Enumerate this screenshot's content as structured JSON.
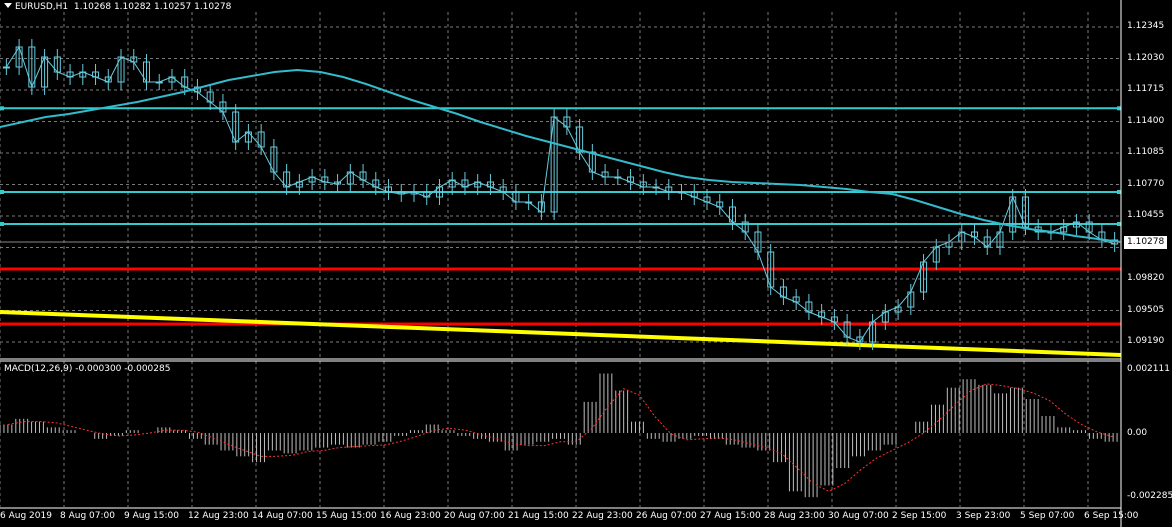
{
  "header": {
    "symbol": "EURUSD,H1",
    "ohlc": "1.10268 1.10282 1.10257 1.10278"
  },
  "macd": {
    "label": "MACD(12,26,9) -0.000300 -0.000285",
    "axis": [
      "0.002111",
      "0.00",
      "-0.002285"
    ]
  },
  "price_axis": [
    "1.12345",
    "1.12030",
    "1.11715",
    "1.11400",
    "1.11085",
    "1.10770",
    "1.10455",
    "1.10135",
    "1.09820",
    "1.09505",
    "1.09190"
  ],
  "current_price": "1.10278",
  "time_axis": [
    "6 Aug 2019",
    "8 Aug 07:00",
    "9 Aug 15:00",
    "12 Aug 23:00",
    "14 Aug 07:00",
    "15 Aug 15:00",
    "16 Aug 23:00",
    "20 Aug 07:00",
    "21 Aug 15:00",
    "22 Aug 23:00",
    "26 Aug 07:00",
    "27 Aug 15:00",
    "28 Aug 23:00",
    "30 Aug 07:00",
    "2 Sep 15:00",
    "3 Sep 23:00",
    "5 Sep 07:00",
    "6 Sep 15:00"
  ],
  "colors": {
    "background": "#000000",
    "grid": "#7a7a7a",
    "candles": "#66ccdd",
    "moving_average": "#33bbcc",
    "level_cyan": "#33cccc",
    "level_red": "#ff0000",
    "trend_yellow": "#ffff00",
    "macd_hist": "#bfbfbf",
    "macd_signal": "#ff3333"
  },
  "chart_data": {
    "type": "line",
    "instrument": "EURUSD",
    "timeframe": "H1",
    "ylim": [
      1.0915,
      1.126
    ],
    "levels": {
      "cyan": [
        1.11637,
        1.108,
        1.1048
      ],
      "red": [
        1.1003,
        1.0948
      ]
    },
    "trendline": {
      "start": 1.096,
      "end": 1.0917
    },
    "close": [
      1.1205,
      1.1225,
      1.1185,
      1.1215,
      1.12,
      1.1195,
      1.12,
      1.1195,
      1.119,
      1.1215,
      1.121,
      1.119,
      1.119,
      1.1195,
      1.1185,
      1.118,
      1.117,
      1.116,
      1.113,
      1.114,
      1.1125,
      1.11,
      1.1085,
      1.109,
      1.1095,
      1.109,
      1.1088,
      1.11,
      1.1092,
      1.1085,
      1.108,
      1.1078,
      1.108,
      1.1075,
      1.1085,
      1.1092,
      1.1085,
      1.109,
      1.1085,
      1.108,
      1.107,
      1.107,
      1.106,
      1.1155,
      1.1145,
      1.112,
      1.11,
      1.1095,
      1.1095,
      1.109,
      1.1085,
      1.1085,
      1.108,
      1.108,
      1.1075,
      1.107,
      1.1065,
      1.105,
      1.104,
      1.102,
      1.0985,
      1.0975,
      1.097,
      1.096,
      1.0955,
      1.095,
      1.0935,
      1.093,
      1.095,
      1.096,
      1.0965,
      1.098,
      1.101,
      1.1025,
      1.103,
      1.104,
      1.1035,
      1.1025,
      1.104,
      1.1075,
      1.1045,
      1.104,
      1.104,
      1.1045,
      1.105,
      1.104,
      1.1032,
      1.1028
    ],
    "ma": [
      1.1145,
      1.115,
      1.1155,
      1.1158,
      1.1162,
      1.1166,
      1.117,
      1.1175,
      1.118,
      1.1186,
      1.1192,
      1.1196,
      1.12,
      1.1202,
      1.12,
      1.1195,
      1.1188,
      1.118,
      1.1172,
      1.1165,
      1.1158,
      1.115,
      1.1143,
      1.1136,
      1.113,
      1.1124,
      1.1118,
      1.1112,
      1.1106,
      1.11,
      1.1095,
      1.1092,
      1.109,
      1.1089,
      1.1088,
      1.1087,
      1.1085,
      1.1083,
      1.108,
      1.1078,
      1.1072,
      1.1065,
      1.1058,
      1.1052,
      1.1047,
      1.1043,
      1.104,
      1.1036,
      1.1033,
      1.103
    ],
    "macd_hist": [
      0.0003,
      0.0005,
      0.0004,
      0.0002,
      0.0001,
      0.0,
      -0.0002,
      -0.0001,
      0.0001,
      0.0,
      0.0002,
      0.0001,
      -0.0002,
      -0.0004,
      -0.0006,
      -0.0008,
      -0.001,
      -0.0006,
      -0.0007,
      -0.0006,
      -0.0005,
      -0.0004,
      -0.0005,
      -0.0004,
      -0.0003,
      -0.0001,
      0.0001,
      0.0003,
      0.0001,
      -0.0001,
      -0.0002,
      -0.0003,
      -0.0006,
      -0.0004,
      -0.0003,
      -0.0002,
      -0.0004,
      0.0011,
      0.0021,
      0.0015,
      0.0004,
      -0.0002,
      -0.0003,
      -0.0002,
      -0.0001,
      -0.0002,
      -0.0004,
      -0.0005,
      -0.0006,
      -0.001,
      -0.002,
      -0.0022,
      -0.0018,
      -0.0012,
      -0.0008,
      -0.0006,
      -0.0004,
      0.0,
      0.0004,
      0.001,
      0.0016,
      0.0019,
      0.0017,
      0.0014,
      0.0016,
      0.0012,
      0.0006,
      0.0002,
      0.0001,
      -0.0002,
      -0.0003
    ]
  }
}
